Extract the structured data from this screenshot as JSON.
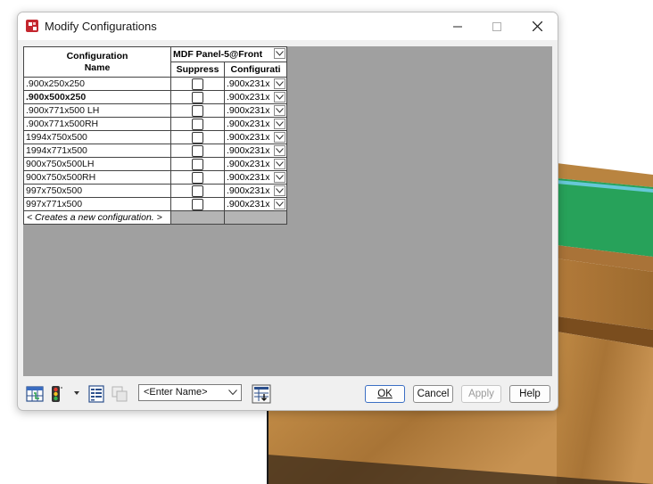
{
  "window": {
    "title": "Modify Configurations"
  },
  "table": {
    "name_header_line1": "Configuration",
    "name_header_line2": "Name",
    "feature_header": "MDF Panel-5@Front",
    "columns": [
      "Suppress",
      "Configurati"
    ],
    "rows": [
      {
        "name": ".900x250x250",
        "bold": false,
        "suppressed": false,
        "config": ".900x231x"
      },
      {
        "name": ".900x500x250",
        "bold": true,
        "suppressed": false,
        "config": ".900x231x"
      },
      {
        "name": ".900x771x500 LH",
        "bold": false,
        "suppressed": false,
        "config": ".900x231x"
      },
      {
        "name": ".900x771x500RH",
        "bold": false,
        "suppressed": false,
        "config": ".900x231x"
      },
      {
        "name": "1994x750x500",
        "bold": false,
        "suppressed": false,
        "config": ".900x231x"
      },
      {
        "name": "1994x771x500",
        "bold": false,
        "suppressed": false,
        "config": ".900x231x"
      },
      {
        "name": "900x750x500LH",
        "bold": false,
        "suppressed": false,
        "config": ".900x231x"
      },
      {
        "name": "900x750x500RH",
        "bold": false,
        "suppressed": false,
        "config": ".900x231x"
      },
      {
        "name": "997x750x500",
        "bold": false,
        "suppressed": false,
        "config": ".900x231x"
      },
      {
        "name": "997x771x500",
        "bold": false,
        "suppressed": false,
        "config": ".900x231x"
      }
    ],
    "new_config_label": "< Creates a new configuration. >"
  },
  "toolbar": {
    "name_placeholder": "<Enter Name>",
    "ok_label": "OK",
    "cancel_label": "Cancel",
    "apply_label": "Apply",
    "help_label": "Help"
  },
  "colors": {
    "grid_background": "#a0a0a0",
    "wood": "#b5823f",
    "green_panel": "#27a25a"
  },
  "icons": [
    "app-icon",
    "minimize-icon",
    "maximize-icon",
    "close-icon",
    "parameters-icon",
    "traffic-light-icon",
    "tables-icon",
    "copy-table-icon",
    "save-table-icon"
  ]
}
